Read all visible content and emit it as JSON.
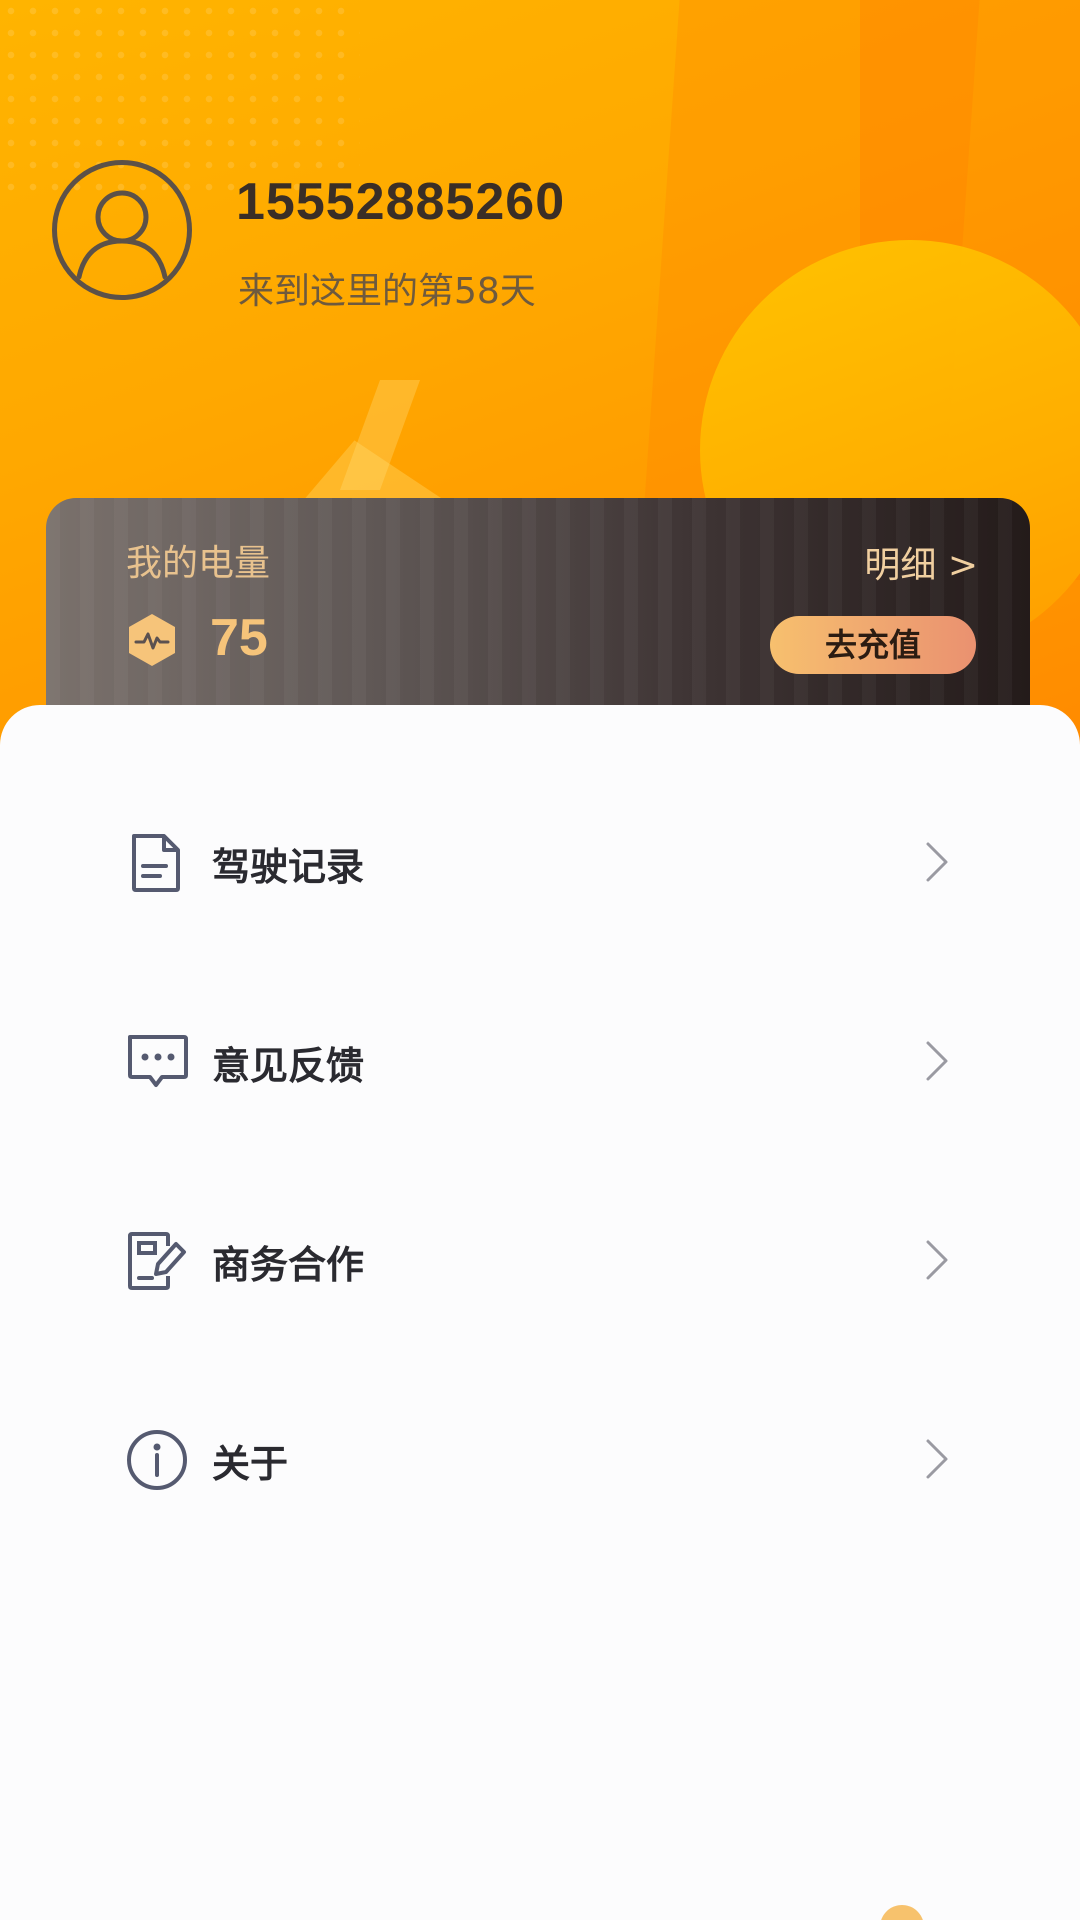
{
  "profile": {
    "username": "15552885260",
    "days_text": "来到这里的第58天"
  },
  "energy": {
    "label": "我的电量",
    "detail_link": "明细 >",
    "value": "75",
    "recharge_label": "去充值"
  },
  "menu": {
    "items": [
      {
        "label": "驾驶记录",
        "icon": "document-icon"
      },
      {
        "label": "意见反馈",
        "icon": "chat-bubble-icon"
      },
      {
        "label": "商务合作",
        "icon": "edit-form-icon"
      },
      {
        "label": "关于",
        "icon": "info-icon"
      }
    ]
  },
  "colors": {
    "header_orange": "#ffa800",
    "card_gold_text": "#f6c47a",
    "icon_stroke": "#555a70",
    "chevron": "#9a9aa2"
  }
}
